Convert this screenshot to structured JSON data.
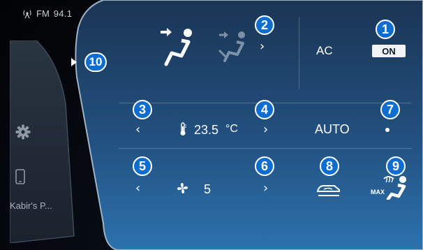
{
  "status": {
    "radio_band": "FM",
    "radio_freq": "94.1"
  },
  "sidebar": {
    "device_name": "Kabir's P..."
  },
  "airflow": {
    "selected_mode_icon": "airflow-face-icon",
    "alt_mode_icon": "airflow-face-feet-icon"
  },
  "ac": {
    "label": "AC",
    "toggle": "ON"
  },
  "temperature": {
    "value": "23.5",
    "unit": "°C"
  },
  "auto": {
    "label": "AUTO"
  },
  "fan": {
    "speed": "5"
  },
  "max_defrost": {
    "label": "MAX"
  },
  "badges": {
    "b1": "1",
    "b2": "2",
    "b3": "3",
    "b4": "4",
    "b5": "5",
    "b6": "6",
    "b7": "7",
    "b8": "8",
    "b9": "9",
    "b10": "10"
  },
  "colors": {
    "panel_top": "#1d3b5e",
    "panel_bottom": "#2b6ba6",
    "badge": "#0e6dcf"
  }
}
